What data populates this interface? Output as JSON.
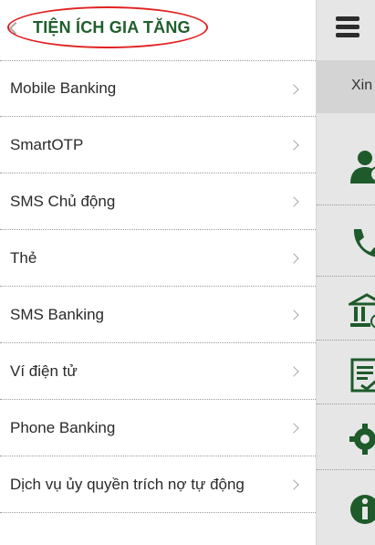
{
  "drawer": {
    "title": "TIỆN ÍCH GIA TĂNG",
    "items": [
      {
        "label": "Mobile Banking"
      },
      {
        "label": "SmartOTP"
      },
      {
        "label": "SMS Chủ động"
      },
      {
        "label": "Thẻ"
      },
      {
        "label": "SMS Banking"
      },
      {
        "label": "Ví điện tử"
      },
      {
        "label": "Phone Banking"
      },
      {
        "label": "Dịch vụ ủy quyền trích nợ tự động"
      }
    ]
  },
  "main": {
    "greeting_partial": "Xin"
  },
  "colors": {
    "title_green": "#1e5f2c",
    "highlight_oval": "#e02222",
    "right_panel_bg": "#e6e6e6"
  },
  "icons": [
    "back-chevron-icon",
    "chevron-right-icon",
    "hamburger-menu-icon",
    "user-account-icon",
    "phone-icon",
    "bank-icon",
    "document-icon",
    "settings-icon",
    "info-icon"
  ]
}
